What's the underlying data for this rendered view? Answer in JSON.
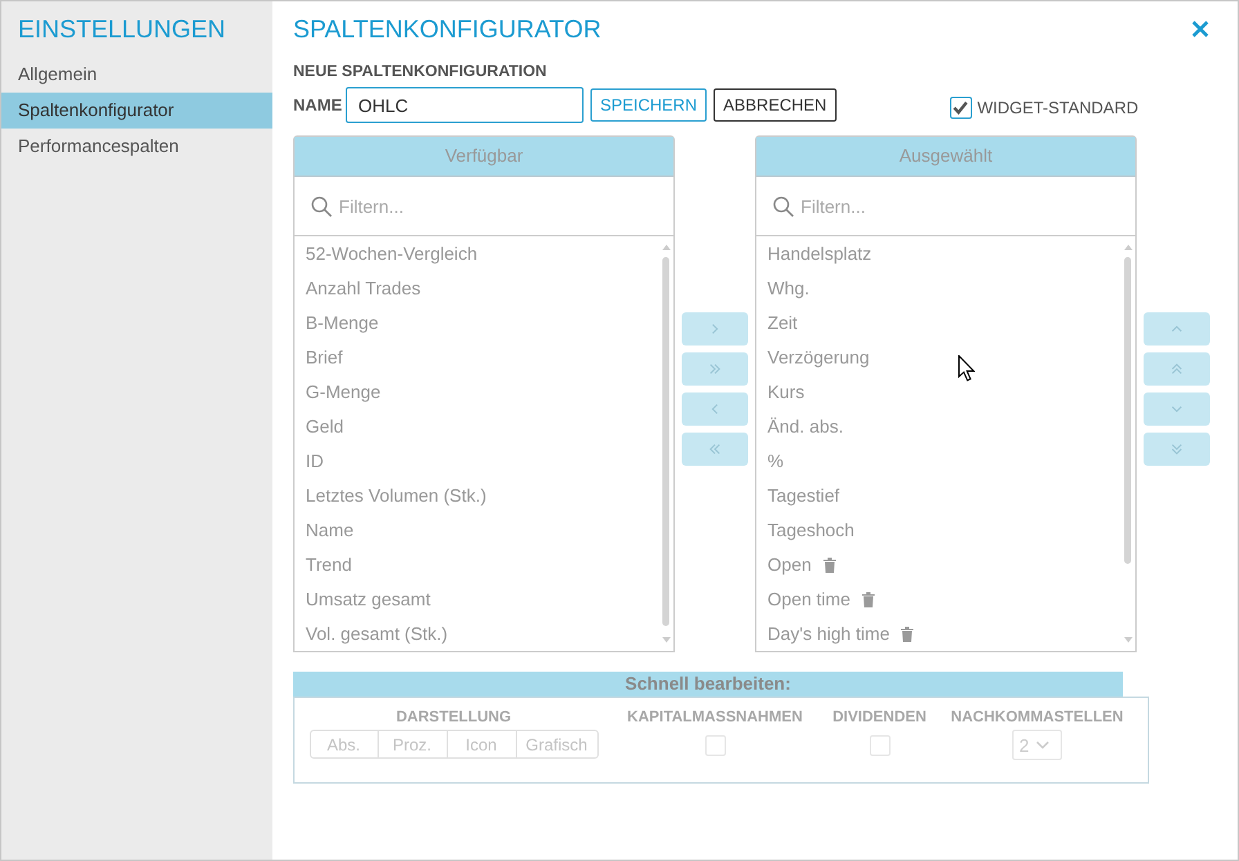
{
  "sidebar": {
    "title": "EINSTELLUNGEN",
    "items": [
      {
        "label": "Allgemein",
        "selected": false
      },
      {
        "label": "Spaltenkonfigurator",
        "selected": true
      },
      {
        "label": "Performancespalten",
        "selected": false
      }
    ]
  },
  "header": {
    "title": "SPALTENKONFIGURATOR"
  },
  "form": {
    "heading": "NEUE SPALTENKONFIGURATION",
    "name_label": "NAME",
    "name_value": "OHLC",
    "buttons": [
      {
        "label": "SPEICHERN",
        "kind": "primary"
      },
      {
        "label": "ABBRECHEN",
        "kind": "secondary"
      }
    ],
    "widget_default": {
      "label": "WIDGET-STANDARD",
      "checked": true
    }
  },
  "available": {
    "title": "Verfügbar",
    "placeholder": "Filtern...",
    "items": [
      {
        "label": "52-Wochen-Vergleich",
        "selected": false,
        "deletable": false
      },
      {
        "label": "Anzahl Trades",
        "selected": false,
        "deletable": false
      },
      {
        "label": "B-Menge",
        "selected": false,
        "deletable": false
      },
      {
        "label": "Brief",
        "selected": false,
        "deletable": false
      },
      {
        "label": "G-Menge",
        "selected": false,
        "deletable": false
      },
      {
        "label": "Geld",
        "selected": false,
        "deletable": false
      },
      {
        "label": "ID",
        "selected": false,
        "deletable": false
      },
      {
        "label": "Letztes Volumen (Stk.)",
        "selected": false,
        "deletable": false
      },
      {
        "label": "Name",
        "selected": false,
        "deletable": false
      },
      {
        "label": "Trend",
        "selected": false,
        "deletable": false
      },
      {
        "label": "Umsatz gesamt",
        "selected": false,
        "deletable": false
      },
      {
        "label": "Vol. gesamt (Stk.)",
        "selected": false,
        "deletable": false
      }
    ]
  },
  "selected_columns": {
    "title": "Ausgewählt",
    "placeholder": "Filtern...",
    "items": [
      {
        "label": "Handelsplatz",
        "selected": false,
        "deletable": false
      },
      {
        "label": "Whg.",
        "selected": false,
        "deletable": false
      },
      {
        "label": "Zeit",
        "selected": false,
        "deletable": false
      },
      {
        "label": "Verzögerung",
        "selected": false,
        "deletable": false
      },
      {
        "label": "Kurs",
        "selected": false,
        "deletable": false
      },
      {
        "label": "Änd. abs.",
        "selected": false,
        "deletable": false
      },
      {
        "label": "%",
        "selected": false,
        "deletable": false
      },
      {
        "label": "Tagestief",
        "selected": false,
        "deletable": false
      },
      {
        "label": "Tageshoch",
        "selected": false,
        "deletable": false
      },
      {
        "label": "Open",
        "selected": false,
        "deletable": true
      },
      {
        "label": "Open time",
        "selected": false,
        "deletable": true
      },
      {
        "label": "Day's high time",
        "selected": false,
        "deletable": true
      }
    ]
  },
  "quick_edit": {
    "title": "Schnell bearbeiten:",
    "disabled": true,
    "display": {
      "label": "DARSTELLUNG",
      "options": [
        {
          "label": "Abs.",
          "selected": false
        },
        {
          "label": "Proz.",
          "selected": false
        },
        {
          "label": "Icon",
          "selected": false
        },
        {
          "label": "Grafisch",
          "selected": false
        }
      ]
    },
    "corporate_actions": {
      "label": "KAPITALMASSNAHMEN",
      "checked": false
    },
    "dividends": {
      "label": "DIVIDENDEN",
      "checked": false
    },
    "decimals": {
      "label": "NACHKOMMASTELLEN",
      "value": "2"
    }
  }
}
